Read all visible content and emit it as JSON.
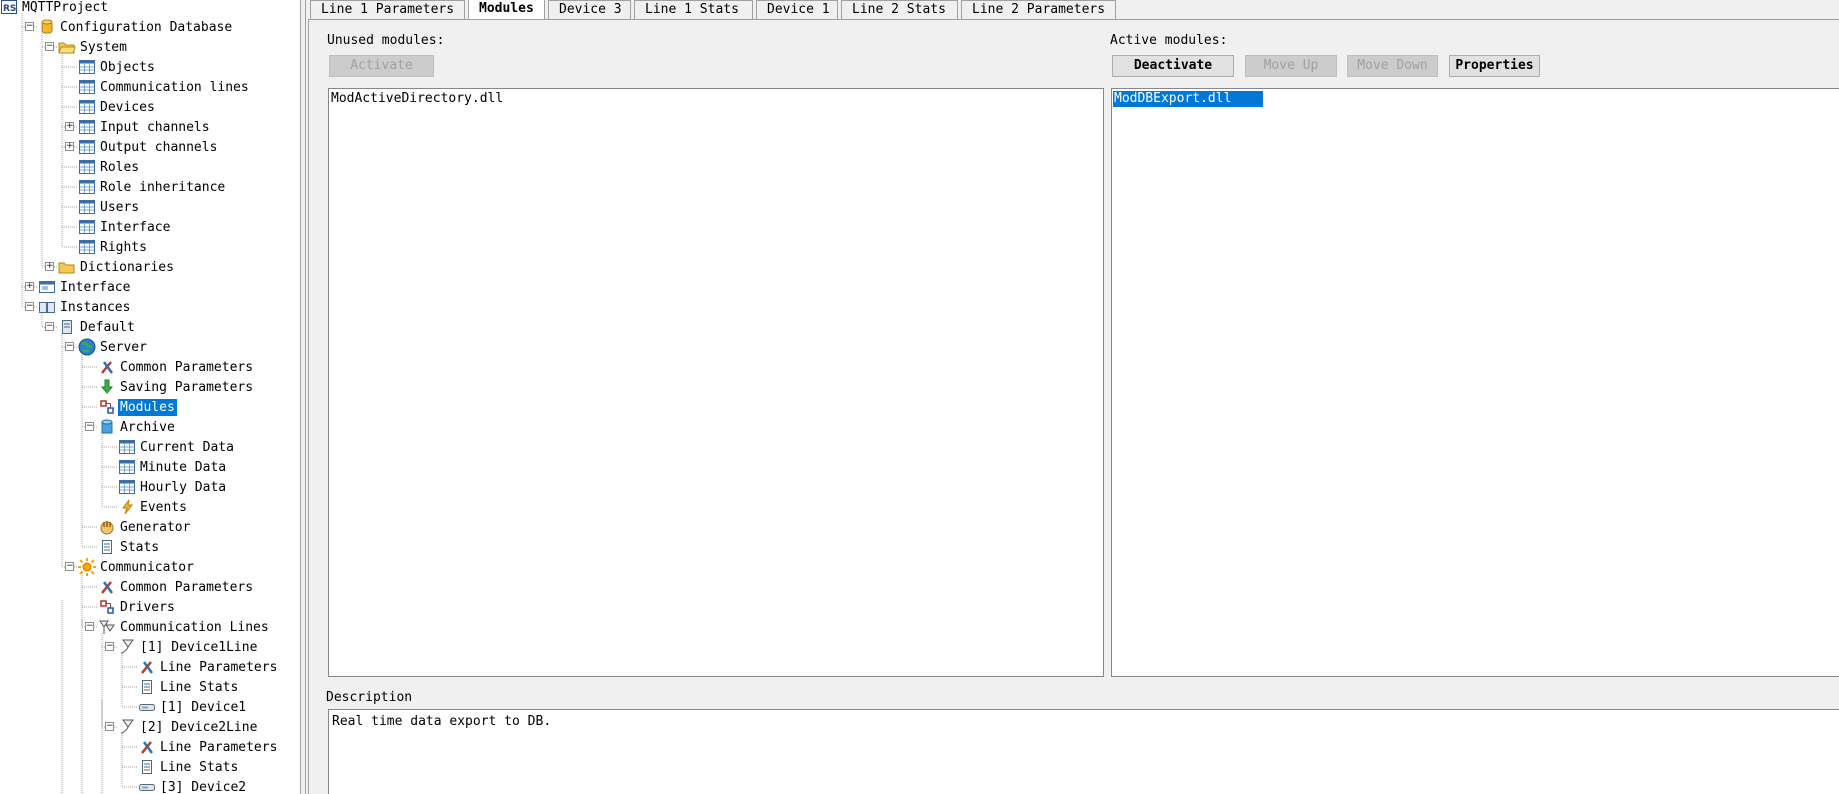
{
  "tree": {
    "nodes": [
      {
        "id": "n0",
        "label": "MQTTProject",
        "icon": "rs-project-icon",
        "expander": ""
      },
      {
        "id": "n1",
        "label": "Configuration Database",
        "icon": "database-icon",
        "expander": "−"
      },
      {
        "id": "n2",
        "label": "System",
        "icon": "folder-open-icon",
        "expander": "−"
      },
      {
        "id": "n3",
        "label": "Objects",
        "icon": "table-icon",
        "expander": ""
      },
      {
        "id": "n4",
        "label": "Communication lines",
        "icon": "table-icon",
        "expander": ""
      },
      {
        "id": "n5",
        "label": "Devices",
        "icon": "table-icon",
        "expander": ""
      },
      {
        "id": "n6",
        "label": "Input channels",
        "icon": "table-icon",
        "expander": "+"
      },
      {
        "id": "n7",
        "label": "Output channels",
        "icon": "table-icon",
        "expander": "+"
      },
      {
        "id": "n8",
        "label": "Roles",
        "icon": "table-icon",
        "expander": ""
      },
      {
        "id": "n9",
        "label": "Role inheritance",
        "icon": "table-icon",
        "expander": ""
      },
      {
        "id": "n10",
        "label": "Users",
        "icon": "table-icon",
        "expander": ""
      },
      {
        "id": "n11",
        "label": "Interface",
        "icon": "table-icon",
        "expander": ""
      },
      {
        "id": "n12",
        "label": "Rights",
        "icon": "table-icon",
        "expander": ""
      },
      {
        "id": "n13",
        "label": "Dictionaries",
        "icon": "folder-icon",
        "expander": "+"
      },
      {
        "id": "n14",
        "label": "Interface",
        "icon": "interface-window-icon",
        "expander": "+"
      },
      {
        "id": "n15",
        "label": "Instances",
        "icon": "instances-icon",
        "expander": "−"
      },
      {
        "id": "n16",
        "label": "Default",
        "icon": "instance-icon",
        "expander": "−"
      },
      {
        "id": "n17",
        "label": "Server",
        "icon": "globe-icon",
        "expander": "−"
      },
      {
        "id": "n18",
        "label": "Common Parameters",
        "icon": "tools-icon",
        "expander": ""
      },
      {
        "id": "n19",
        "label": "Saving Parameters",
        "icon": "save-arrow-icon",
        "expander": ""
      },
      {
        "id": "n20",
        "label": "Modules",
        "icon": "modules-icon",
        "expander": ""
      },
      {
        "id": "n21",
        "label": "Archive",
        "icon": "cylinder-icon",
        "expander": "−"
      },
      {
        "id": "n22",
        "label": "Current Data",
        "icon": "table-icon",
        "expander": ""
      },
      {
        "id": "n23",
        "label": "Minute Data",
        "icon": "table-icon",
        "expander": ""
      },
      {
        "id": "n24",
        "label": "Hourly Data",
        "icon": "table-icon",
        "expander": ""
      },
      {
        "id": "n25",
        "label": "Events",
        "icon": "lightning-icon",
        "expander": ""
      },
      {
        "id": "n26",
        "label": "Generator",
        "icon": "hand-icon",
        "expander": ""
      },
      {
        "id": "n27",
        "label": "Stats",
        "icon": "document-icon",
        "expander": ""
      },
      {
        "id": "n28",
        "label": "Communicator",
        "icon": "sun-icon",
        "expander": "−"
      },
      {
        "id": "n29",
        "label": "Common Parameters",
        "icon": "tools-icon",
        "expander": ""
      },
      {
        "id": "n30",
        "label": "Drivers",
        "icon": "modules-icon",
        "expander": ""
      },
      {
        "id": "n31",
        "label": "Communication Lines",
        "icon": "comm-lines-icon",
        "expander": "−"
      },
      {
        "id": "n32",
        "label": "[1] Device1Line",
        "icon": "comm-line-icon",
        "expander": "−"
      },
      {
        "id": "n33",
        "label": "Line Parameters",
        "icon": "tools-icon",
        "expander": ""
      },
      {
        "id": "n34",
        "label": "Line Stats",
        "icon": "document-icon",
        "expander": ""
      },
      {
        "id": "n35",
        "label": "[1] Device1",
        "icon": "device-icon",
        "expander": ""
      },
      {
        "id": "n36",
        "label": "[2] Device2Line",
        "icon": "comm-line-icon",
        "expander": "−"
      },
      {
        "id": "n37",
        "label": "Line Parameters",
        "icon": "tools-icon",
        "expander": ""
      },
      {
        "id": "n38",
        "label": "Line Stats",
        "icon": "document-icon",
        "expander": ""
      },
      {
        "id": "n39",
        "label": "[3] Device2",
        "icon": "device-icon",
        "expander": ""
      }
    ],
    "selected_label": "Modules"
  },
  "tabs": [
    {
      "label": "Line 1 Parameters"
    },
    {
      "label": "Modules"
    },
    {
      "label": "Device 3"
    },
    {
      "label": "Line 1 Stats"
    },
    {
      "label": "Device 1"
    },
    {
      "label": "Line 2 Stats"
    },
    {
      "label": "Line 2 Parameters"
    }
  ],
  "modules_page": {
    "unused_caption": "Unused modules:",
    "active_caption": "Active modules:",
    "activate_label": "Activate",
    "deactivate_label": "Deactivate",
    "move_up_label": "Move Up",
    "move_down_label": "Move Down",
    "properties_label": "Properties",
    "unused_modules": [
      "ModActiveDirectory.dll"
    ],
    "active_modules": [
      "ModDBExport.dll"
    ],
    "description_caption": "Description",
    "description_text": "Real time data export to DB."
  },
  "colors": {
    "selection": "#0078d7",
    "panel_bg": "#f0f0f0"
  }
}
